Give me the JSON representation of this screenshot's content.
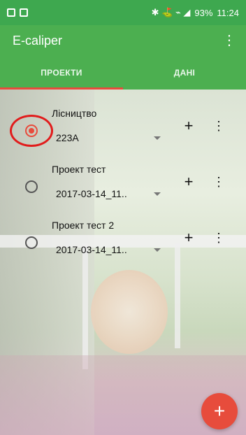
{
  "status_bar": {
    "right_icons_text": "✱ ⛳ ⌁ ◢",
    "battery": "93%",
    "time": "11:24"
  },
  "app": {
    "title": "E-caliper",
    "menu_icon": "more-vert-icon"
  },
  "tabs": [
    {
      "label": "ПРОЕКТИ",
      "active": true
    },
    {
      "label": "ДАНІ",
      "active": false
    }
  ],
  "projects": [
    {
      "name": "Лісництво",
      "selected_value": "223A",
      "selected": true
    },
    {
      "name": "Проект тест",
      "selected_value": "2017-03-14_11..",
      "selected": false
    },
    {
      "name": "Проект тест 2",
      "selected_value": "2017-03-14_11..",
      "selected": false
    }
  ],
  "fab": {
    "icon": "plus-icon",
    "label": "+"
  },
  "colors": {
    "primary": "#4caf50",
    "primary_dark": "#3ea84f",
    "accent": "#e84b3c",
    "annotation": "#e11c1c"
  }
}
